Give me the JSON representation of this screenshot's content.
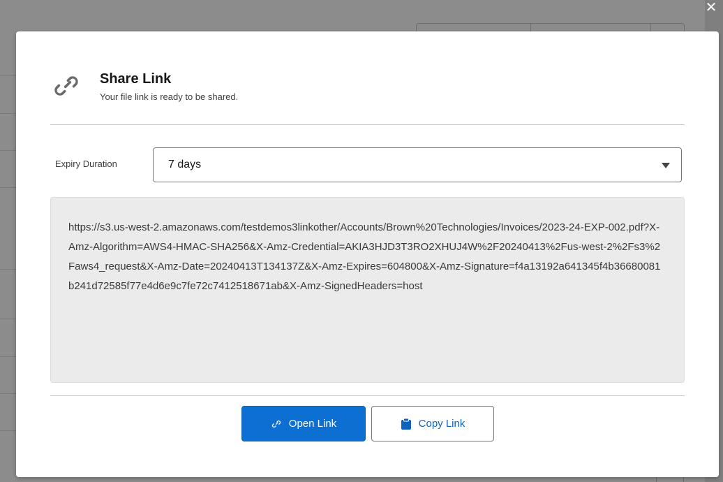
{
  "modal": {
    "title": "Share Link",
    "subtitle": "Your file link is ready to be shared.",
    "close_icon": "close-icon",
    "header_icon": "link-icon"
  },
  "expiry": {
    "label": "Expiry Duration",
    "selected": "7 days"
  },
  "url": "https://s3.us-west-2.amazonaws.com/testdemos3linkother/Accounts/Brown%20Technologies/Invoices/2023-24-EXP-002.pdf?X-Amz-Algorithm=AWS4-HMAC-SHA256&X-Amz-Credential=AKIA3HJD3T3RO2XHUJ4W%2F20240413%2Fus-west-2%2Fs3%2Faws4_request&X-Amz-Date=20240413T134137Z&X-Amz-Expires=604800&X-Amz-Signature=f4a13192a641345f4b36680081b241d72585f77e4d6e9c7fe72c7412518671ab&X-Amz-SignedHeaders=host",
  "buttons": {
    "open": "Open Link",
    "copy": "Copy Link"
  },
  "colors": {
    "brand_button": "#0c6fd1",
    "brand_text": "#0b63bb"
  }
}
